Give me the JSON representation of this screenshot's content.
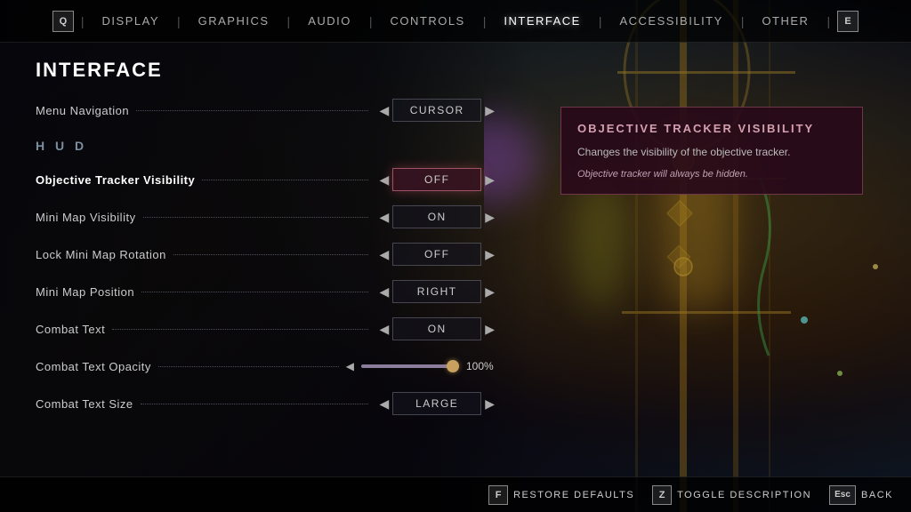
{
  "nav": {
    "left_key": "Q",
    "right_key": "E",
    "items": [
      {
        "label": "DISPLAY",
        "active": false
      },
      {
        "label": "GRAPHICS",
        "active": false
      },
      {
        "label": "AUDIO",
        "active": false
      },
      {
        "label": "CONTROLS",
        "active": false
      },
      {
        "label": "INTERFACE",
        "active": true
      },
      {
        "label": "ACCESSIBILITY",
        "active": false
      },
      {
        "label": "OTHER",
        "active": false
      }
    ]
  },
  "page": {
    "title": "INTERFACE"
  },
  "menu_navigation": {
    "label": "Menu Navigation",
    "value": "CURSOR"
  },
  "hud_label": "H U D",
  "settings": [
    {
      "id": "objective-tracker",
      "label": "Objective Tracker Visibility",
      "value": "OFF",
      "type": "toggle",
      "active": true,
      "value_style": "off"
    },
    {
      "id": "mini-map-visibility",
      "label": "Mini Map Visibility",
      "value": "ON",
      "type": "toggle",
      "active": false,
      "value_style": "normal"
    },
    {
      "id": "lock-mini-map",
      "label": "Lock Mini Map Rotation",
      "value": "OFF",
      "type": "toggle",
      "active": false,
      "value_style": "normal"
    },
    {
      "id": "mini-map-position",
      "label": "Mini Map Position",
      "value": "RIGHT",
      "type": "selector",
      "active": false,
      "value_style": "normal"
    },
    {
      "id": "combat-text",
      "label": "Combat Text",
      "value": "ON",
      "type": "toggle",
      "active": false,
      "value_style": "normal"
    },
    {
      "id": "combat-text-opacity",
      "label": "Combat Text Opacity",
      "value": "100%",
      "type": "slider",
      "fill_percent": 100,
      "active": false
    },
    {
      "id": "combat-text-size",
      "label": "Combat Text Size",
      "value": "LARGE",
      "type": "selector",
      "active": false,
      "value_style": "normal"
    }
  ],
  "tooltip": {
    "title": "OBJECTIVE TRACKER VISIBILITY",
    "description": "Changes the visibility of the objective tracker.",
    "note": "Objective tracker will always be hidden."
  },
  "bottom_bar": {
    "restore_key": "F",
    "restore_label": "RESTORE DEFAULTS",
    "toggle_key": "Z",
    "toggle_label": "TOGGLE DESCRIPTION",
    "back_key": "Esc",
    "back_label": "BACK"
  }
}
